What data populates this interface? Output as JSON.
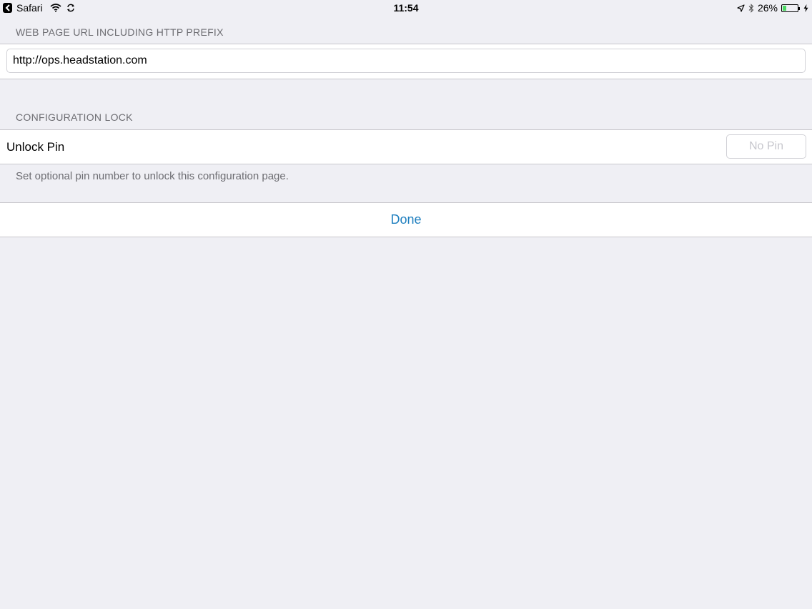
{
  "status_bar": {
    "back_app": "Safari",
    "time": "11:54",
    "battery_percent": "26%",
    "battery_level": 0.26,
    "battery_fill_color": "#4cd964",
    "icons": [
      "back-arrow-icon",
      "wifi-icon",
      "sync-icon",
      "location-arrow-icon",
      "bluetooth-icon",
      "battery-icon",
      "charging-bolt-icon"
    ]
  },
  "url_section": {
    "header": "WEB PAGE URL INCLUDING HTTP PREFIX",
    "value": "http://ops.headstation.com"
  },
  "lock_section": {
    "header": "CONFIGURATION LOCK",
    "unlock_label": "Unlock Pin",
    "pin_placeholder": "No Pin",
    "footer": "Set optional pin number to unlock this configuration page."
  },
  "actions": {
    "done_label": "Done",
    "accent_color": "#1f7fbf"
  }
}
